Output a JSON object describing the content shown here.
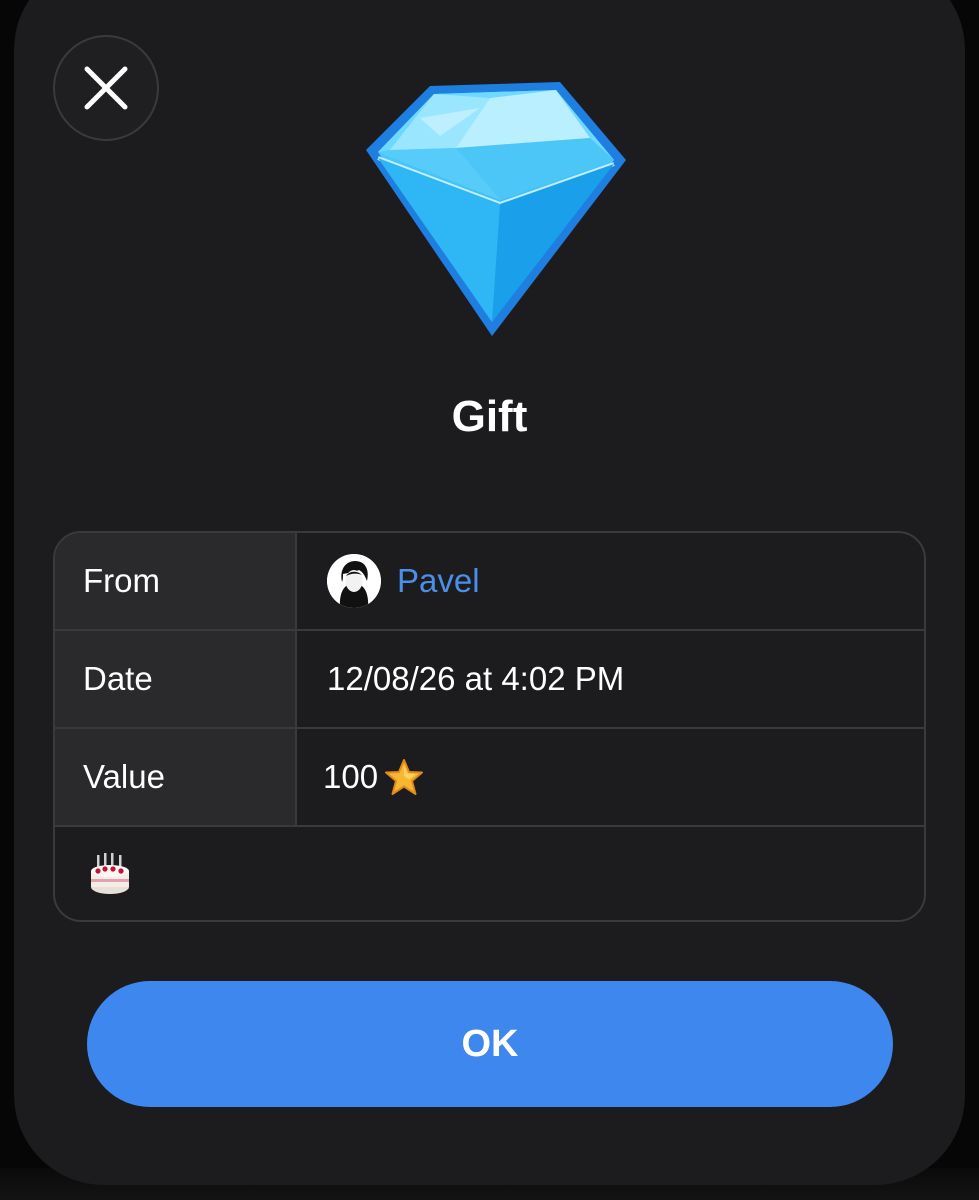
{
  "dialog": {
    "title": "Gift",
    "gift_icon": "diamond-icon",
    "close_icon": "close-icon"
  },
  "details": {
    "from": {
      "label": "From",
      "value": "Pavel",
      "avatar_icon": "avatar"
    },
    "date": {
      "label": "Date",
      "value": "12/08/26 at 4:02 PM"
    },
    "value": {
      "label": "Value",
      "amount": "100",
      "unit_icon": "star-icon"
    },
    "note_icon": "birthday-cake-icon"
  },
  "actions": {
    "ok_label": "OK"
  },
  "colors": {
    "sheet_background": "#1c1c1e",
    "accent": "#3d87ee",
    "link": "#4a8fe8",
    "divider": "#3a3a3c",
    "label_cell": "#2a2a2c"
  }
}
